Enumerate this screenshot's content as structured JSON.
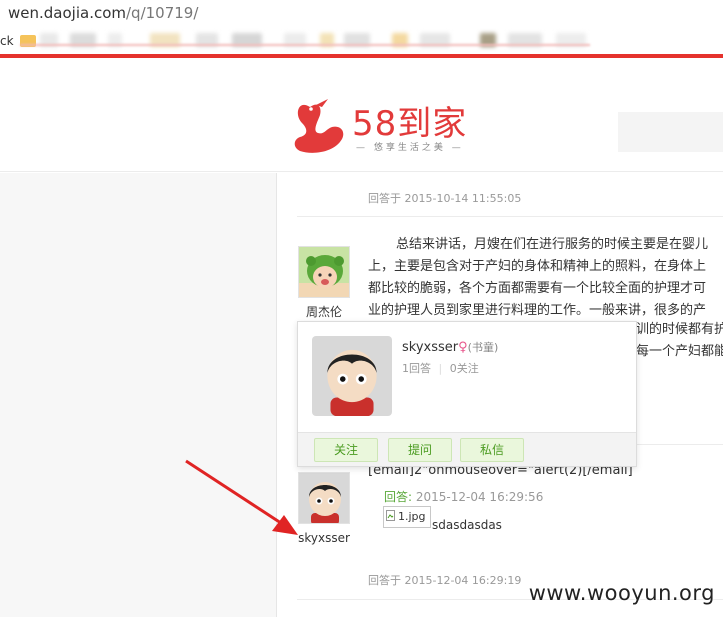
{
  "browser": {
    "url_domain": "wen.daojia.com",
    "url_path": "/q/10719/",
    "bookmark_label": "ck"
  },
  "header": {
    "brand_name": "58到家",
    "slogan": "— 悠享生活之美 —"
  },
  "answers": [
    {
      "reply_time": "回答于 2015-10-14 11:55:05",
      "user_name": "周杰伦",
      "lines": [
        "总结来讲话，月嫂在们在进行服务的时候主要是在婴儿",
        "上，主要是包含对于产妇的身体和精神上的照料，在身体上",
        "都比较的脆弱，各个方面都需要有一个比较全面的护理才可",
        "业的护理人员到家里进行料理的工作。一般来讲，很多的产",
        "训的时候都有护",
        "每一个产妇都能"
      ]
    },
    {
      "user_name": "skyxsser",
      "content": "[email]2\"onmouseover=\"alert(2)[/email]",
      "sub_reply_label": "回答:",
      "sub_reply_time": "2015-12-04 16:29:56",
      "image_alt": "1.jpg",
      "image_caption": "sdasdasdas",
      "reply_time": "回答于 2015-12-04 16:29:19"
    }
  ],
  "popup": {
    "user_name": "skyxsser",
    "gender_icon": "female-icon",
    "level": "(书童)",
    "answers_count": "1回答",
    "follow_count": "0关注",
    "buttons": {
      "follow": "关注",
      "ask": "提问",
      "message": "私信"
    }
  },
  "watermark": "www.wooyun.org",
  "colors": {
    "brand_red": "#e23a3a",
    "accent_red_bar": "#e5322d",
    "green": "#4a9b20",
    "female_pink": "#e8578c",
    "arrow_red": "#e02424"
  }
}
